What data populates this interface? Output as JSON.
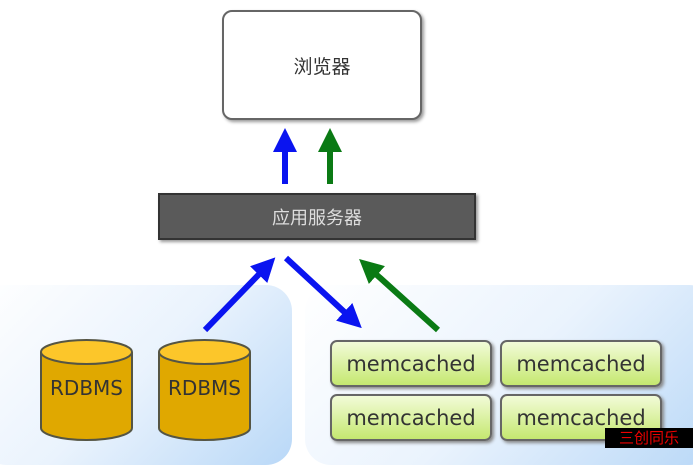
{
  "browser": {
    "label": "浏览器"
  },
  "app_server": {
    "label": "应用服务器"
  },
  "databases": [
    {
      "label": "RDBMS"
    },
    {
      "label": "RDBMS"
    }
  ],
  "caches": [
    {
      "label": "memcached"
    },
    {
      "label": "memcached"
    },
    {
      "label": "memcached"
    },
    {
      "label": "memcached"
    }
  ],
  "watermark": "三创同乐",
  "colors": {
    "blue_arrow": "#0a14f0",
    "green_arrow": "#0a7a14",
    "db_fill": "#f5b800",
    "cache_fill": "#c5e870",
    "server_fill": "#5a5a5a"
  }
}
